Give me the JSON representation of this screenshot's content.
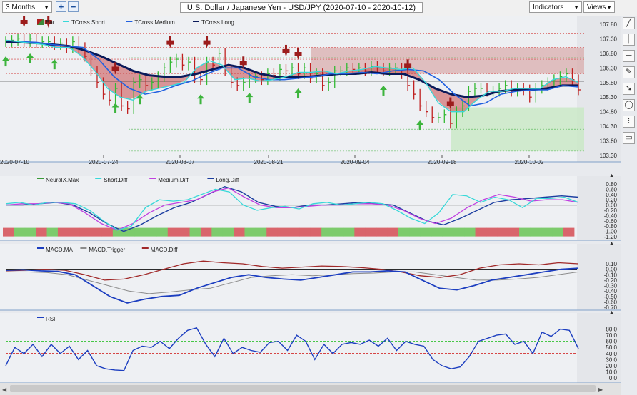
{
  "toolbar": {
    "range_label": "3 Months",
    "zoom_in": "+",
    "zoom_out": "−",
    "title": "U.S. Dollar / Japanese Yen - USD/JPY (2020-07-10 - 2020-10-12)",
    "indicators_label": "Indicators",
    "views_label": "Views"
  },
  "side_icons": [
    "line-tool-icon",
    "vertical-line-icon",
    "horizontal-line-icon",
    "pencil-icon",
    "arrow-icon",
    "circle-icon",
    "dots-icon",
    "chat-icon"
  ],
  "chart_data": [
    {
      "type": "line",
      "panel": "price",
      "legend": [
        "Bar",
        "TCross.Short",
        "TCross.Medium",
        "TCross.Long"
      ],
      "x_labels": [
        "2020-07-10",
        "2020-07-24",
        "2020-08-07",
        "2020-08-21",
        "2020-09-04",
        "2020-09-18",
        "2020-10-02"
      ],
      "y_ticks": [
        107.8,
        107.3,
        106.8,
        106.3,
        105.8,
        105.3,
        104.8,
        104.3,
        103.8,
        103.3
      ],
      "ylim": [
        103.3,
        107.8
      ],
      "horizontal_line": 105.85,
      "colors": {
        "bar_up": "#33b933",
        "bar_down": "#c02020",
        "short": "#38d8d8",
        "medium": "#2060e0",
        "long": "#0a1a5a"
      },
      "closes": [
        107.2,
        107.25,
        107.3,
        107.2,
        107.3,
        107.15,
        107.2,
        107.2,
        107.1,
        107.15,
        107.0,
        107.2,
        107.0,
        106.7,
        106.2,
        105.8,
        105.4,
        105.2,
        105.6,
        105.0,
        104.9,
        105.8,
        105.9,
        105.7,
        105.8,
        106.0,
        106.3,
        106.5,
        106.6,
        106.4,
        106.5,
        105.95,
        105.9,
        106.5,
        106.4,
        106.8,
        106.2,
        105.8,
        105.7,
        105.8,
        105.95,
        106.0,
        105.9,
        106.1,
        106.05,
        106.25,
        106.2,
        106.3,
        106.1,
        106.3,
        105.95,
        106.1,
        105.7,
        105.8,
        106.2,
        106.2,
        106.3,
        106.25,
        106.3,
        106.2,
        106.35,
        106.3,
        106.2,
        106.3,
        106.3,
        106.1,
        105.7,
        105.4,
        105.0,
        104.8,
        104.6,
        104.6,
        104.7,
        104.4,
        104.8,
        105.0,
        105.5,
        105.6,
        105.6,
        105.5,
        105.5,
        105.6,
        105.7,
        105.5,
        105.6,
        105.55,
        105.3,
        105.6,
        105.7,
        105.8,
        105.9,
        106.0,
        106.1,
        105.9,
        105.55
      ],
      "tcross_short": [
        107.25,
        107.2,
        107.15,
        107.1,
        107.0,
        107.0,
        106.7,
        106.2,
        105.6,
        105.3,
        105.2,
        105.5,
        105.6,
        105.7,
        105.8,
        106.3,
        106.55,
        106.4,
        105.9,
        105.95,
        105.85,
        105.9,
        106.0,
        106.15,
        106.15,
        106.2,
        106.1,
        106.2,
        106.25,
        106.35,
        106.3,
        106.25,
        106.3,
        105.8,
        105.1,
        104.8,
        104.8,
        105.2,
        105.5,
        105.5,
        105.6,
        105.6,
        105.6,
        105.9,
        106.0,
        105.8
      ],
      "tcross_medium": [
        107.25,
        107.2,
        107.18,
        107.1,
        107.05,
        107.0,
        106.6,
        106.0,
        105.6,
        105.4,
        105.5,
        105.7,
        105.85,
        106.1,
        106.3,
        106.3,
        106.0,
        105.9,
        105.9,
        105.95,
        106.0,
        106.1,
        106.1,
        106.15,
        106.1,
        106.2,
        106.25,
        106.2,
        105.9,
        105.4,
        105.0,
        105.1,
        105.4,
        105.5,
        105.55,
        105.55,
        105.7,
        105.65
      ],
      "tcross_long": [
        107.2,
        107.18,
        107.15,
        107.1,
        107.05,
        106.9,
        106.7,
        106.45,
        106.2,
        106.05,
        106.0,
        106.0,
        106.1,
        106.25,
        106.4,
        106.3,
        106.1,
        106.0,
        106.0,
        106.0,
        106.05,
        106.1,
        106.1,
        106.15,
        106.1,
        106.1,
        105.9,
        105.6,
        105.4,
        105.3,
        105.35,
        105.5,
        105.55,
        105.55,
        105.6,
        105.7,
        105.7
      ],
      "sell_signals": [
        3,
        7,
        18,
        27,
        33,
        39,
        46,
        48,
        66,
        73
      ],
      "buy_signals": [
        0,
        4,
        8,
        18,
        22,
        32,
        40,
        48,
        62,
        68
      ]
    },
    {
      "type": "line",
      "panel": "neuralx",
      "legend": [
        "NeuralX.Max",
        "Short.Diff",
        "Medium.Diff",
        "Long.Diff"
      ],
      "y_ticks": [
        0.8,
        0.6,
        0.4,
        0.2,
        0.0,
        -0.2,
        -0.4,
        -0.6,
        -0.8,
        -1.0,
        -1.2
      ],
      "ylim": [
        -1.2,
        0.8
      ],
      "zero_line": 0.0,
      "colors": {
        "short": "#38d8d8",
        "medium": "#c040e0",
        "long": "#1c3ea0",
        "band_up": "#7dcb6c",
        "band_down": "#d9656b"
      },
      "short_diff": [
        0.05,
        0.1,
        0.0,
        0.1,
        0.1,
        0.05,
        -0.2,
        -0.6,
        -0.95,
        -0.8,
        -0.1,
        0.2,
        0.15,
        0.2,
        0.4,
        0.6,
        0.5,
        0.0,
        -0.2,
        -0.1,
        -0.05,
        -0.15,
        0.05,
        0.1,
        0.0,
        0.05,
        0.1,
        0.05,
        -0.2,
        -0.5,
        -0.7,
        -0.3,
        0.4,
        0.35,
        0.1,
        0.3,
        0.2,
        -0.1,
        0.25,
        0.25,
        0.3,
        0.1
      ],
      "medium_diff": [
        0.0,
        0.05,
        0.05,
        0.1,
        0.05,
        -0.3,
        -0.7,
        -0.95,
        -0.7,
        -0.3,
        0.0,
        0.1,
        0.2,
        0.5,
        0.65,
        0.3,
        0.0,
        -0.1,
        -0.1,
        -0.05,
        0.0,
        0.0,
        0.05,
        0.05,
        0.0,
        -0.2,
        -0.5,
        -0.7,
        -0.5,
        -0.1,
        0.2,
        0.4,
        0.3,
        0.15,
        0.2,
        0.2,
        0.1
      ],
      "long_diff": [
        0.0,
        0.0,
        0.05,
        0.1,
        0.0,
        -0.3,
        -0.7,
        -1.0,
        -0.75,
        -0.4,
        -0.1,
        0.1,
        0.4,
        0.7,
        0.5,
        0.1,
        -0.05,
        -0.1,
        0.0,
        0.0,
        0.05,
        0.1,
        0.05,
        0.0,
        -0.3,
        -0.6,
        -0.75,
        -0.5,
        -0.2,
        0.1,
        0.2,
        0.25,
        0.3,
        0.35,
        0.3
      ],
      "band": [
        "d",
        "g",
        "g",
        "d",
        "g",
        "d",
        "d",
        "d",
        "d",
        "d",
        "g",
        "g",
        "g",
        "g",
        "g",
        "d",
        "d",
        "g",
        "d",
        "g",
        "g",
        "d",
        "g",
        "g",
        "d",
        "d",
        "d",
        "d",
        "d",
        "g",
        "g",
        "g",
        "d",
        "d",
        "d",
        "d",
        "g",
        "g",
        "g",
        "g",
        "g",
        "g",
        "g",
        "d",
        "d",
        "d",
        "d",
        "g",
        "g",
        "g",
        "g",
        "d"
      ]
    },
    {
      "type": "line",
      "panel": "macd",
      "legend": [
        "MACD.MA",
        "MACD.Trigger",
        "MACD.Diff"
      ],
      "y_ticks": [
        0.1,
        0.0,
        -0.1,
        -0.2,
        -0.3,
        -0.4,
        -0.5,
        -0.6,
        -0.7
      ],
      "ylim": [
        -0.7,
        0.1
      ],
      "zero_line": 0.0,
      "colors": {
        "ma": "#1c3ec0",
        "trigger": "#8c8c8c",
        "diff": "#a02828"
      },
      "ma": [
        -0.02,
        -0.01,
        -0.03,
        -0.04,
        -0.1,
        -0.3,
        -0.5,
        -0.62,
        -0.55,
        -0.5,
        -0.48,
        -0.35,
        -0.25,
        -0.15,
        -0.1,
        -0.15,
        -0.18,
        -0.2,
        -0.15,
        -0.1,
        -0.05,
        -0.05,
        -0.03,
        -0.05,
        -0.2,
        -0.35,
        -0.38,
        -0.3,
        -0.2,
        -0.15,
        -0.1,
        -0.05,
        0.0,
        0.02
      ],
      "trigger": [
        -0.05,
        -0.05,
        -0.06,
        -0.1,
        -0.2,
        -0.3,
        -0.4,
        -0.45,
        -0.42,
        -0.38,
        -0.35,
        -0.25,
        -0.15,
        -0.12,
        -0.1,
        -0.12,
        -0.1,
        -0.08,
        -0.07,
        -0.05,
        -0.05,
        -0.1,
        -0.15,
        -0.2,
        -0.2,
        -0.18,
        -0.15,
        -0.1,
        -0.05
      ],
      "diff": [
        -0.03,
        -0.02,
        0.0,
        -0.02,
        -0.1,
        -0.2,
        -0.18,
        -0.1,
        0.0,
        0.1,
        0.15,
        0.12,
        0.1,
        0.05,
        0.02,
        0.04,
        0.06,
        0.05,
        0.03,
        0.0,
        -0.05,
        -0.12,
        -0.15,
        -0.1,
        0.02,
        0.08,
        0.1,
        0.08,
        0.12,
        0.1
      ]
    },
    {
      "type": "line",
      "panel": "rsi",
      "legend": [
        "RSI"
      ],
      "y_ticks": [
        80.0,
        70.0,
        60.0,
        50.0,
        40.0,
        30.0,
        20.0,
        10.0,
        0.0
      ],
      "ylim": [
        0,
        90
      ],
      "overbought": 60,
      "oversold": 40,
      "colors": {
        "rsi": "#1c3ec0",
        "overbought": "#2fc12f",
        "oversold": "#d32d2d"
      },
      "values": [
        20,
        50,
        40,
        55,
        35,
        55,
        40,
        52,
        30,
        45,
        20,
        15,
        13,
        12,
        45,
        52,
        50,
        60,
        48,
        65,
        78,
        82,
        55,
        35,
        65,
        40,
        50,
        45,
        42,
        58,
        60,
        45,
        70,
        60,
        30,
        55,
        40,
        55,
        58,
        55,
        62,
        52,
        65,
        45,
        60,
        55,
        52,
        30,
        20,
        15,
        18,
        35,
        60,
        65,
        70,
        72,
        55,
        60,
        40,
        75,
        68,
        80,
        78,
        48
      ]
    }
  ]
}
